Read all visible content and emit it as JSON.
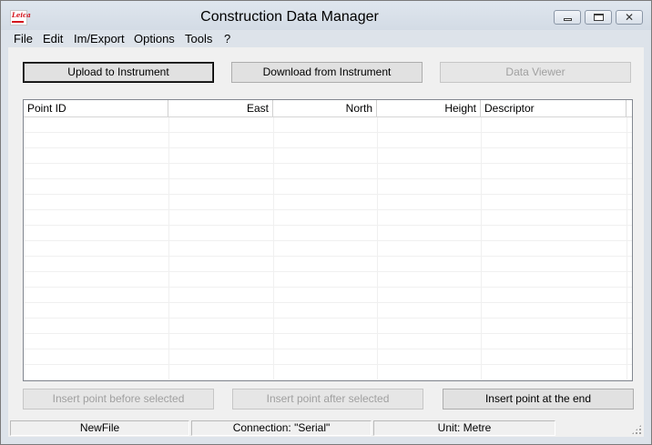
{
  "window": {
    "title": "Construction Data Manager",
    "icon": "leica-app-icon",
    "controls": [
      "minimize-icon",
      "maximize-icon",
      "close-icon"
    ],
    "close_glyph": "✕"
  },
  "menu": [
    "File",
    "Edit",
    "Im/Export",
    "Options",
    "Tools",
    "?"
  ],
  "toolbar": {
    "upload_label": "Upload to Instrument",
    "download_label": "Download from Instrument",
    "viewer_label": "Data Viewer"
  },
  "table": {
    "columns": [
      "Point ID",
      "East",
      "North",
      "Height",
      "Descriptor"
    ],
    "rows": []
  },
  "actions": {
    "insert_before_label": "Insert point before selected",
    "insert_after_label": "Insert point after selected",
    "insert_end_label": "Insert point at the end"
  },
  "status": {
    "file": "NewFile",
    "connection": "Connection: \"Serial\"",
    "unit": "Unit: Metre"
  },
  "colors": {
    "frame": "#dde3ea",
    "client": "#f0f0f0",
    "disabled_text": "#a0a0a0",
    "brand_red": "#d4141c"
  }
}
